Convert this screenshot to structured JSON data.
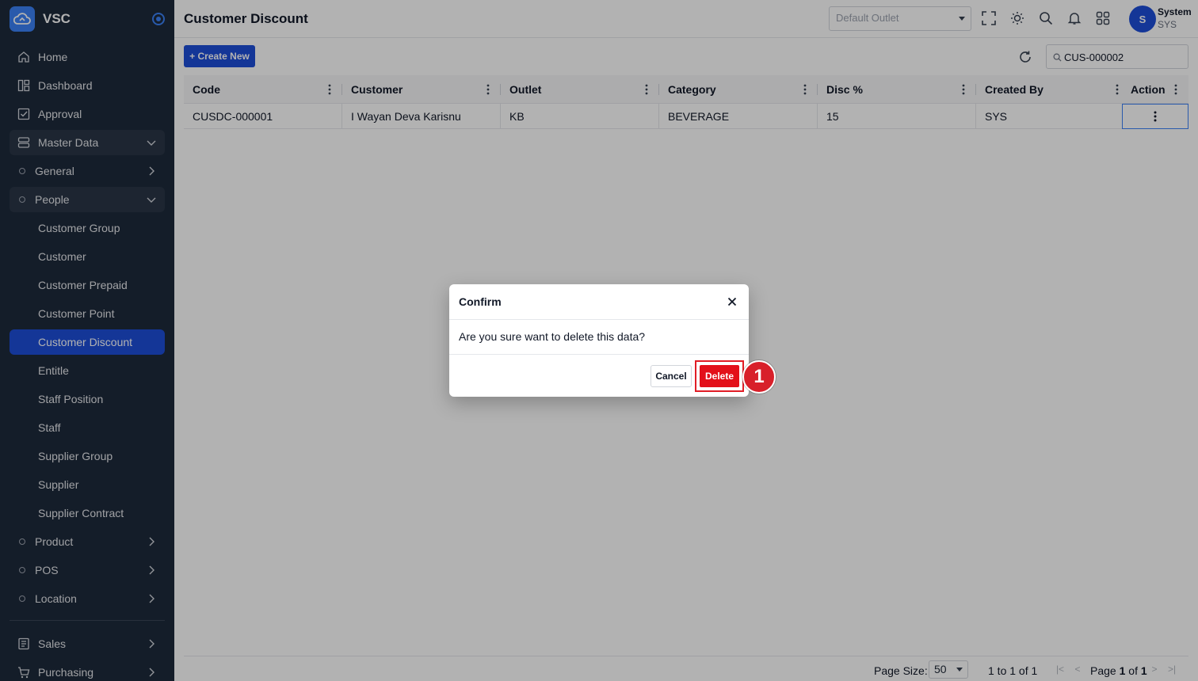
{
  "app": {
    "name": "VSC"
  },
  "sidebar": {
    "items": [
      {
        "label": "Home",
        "icon": "home-icon"
      },
      {
        "label": "Dashboard",
        "icon": "dashboard-icon"
      },
      {
        "label": "Approval",
        "icon": "approval-icon"
      },
      {
        "label": "Master Data",
        "icon": "database-icon"
      },
      {
        "label": "General"
      },
      {
        "label": "People"
      },
      {
        "label": "Customer Group"
      },
      {
        "label": "Customer"
      },
      {
        "label": "Customer Prepaid"
      },
      {
        "label": "Customer Point"
      },
      {
        "label": "Customer Discount"
      },
      {
        "label": "Entitle"
      },
      {
        "label": "Staff Position"
      },
      {
        "label": "Staff"
      },
      {
        "label": "Supplier Group"
      },
      {
        "label": "Supplier"
      },
      {
        "label": "Supplier Contract"
      },
      {
        "label": "Product"
      },
      {
        "label": "POS"
      },
      {
        "label": "Location"
      },
      {
        "label": "Sales",
        "icon": "sales-icon"
      },
      {
        "label": "Purchasing",
        "icon": "cart-icon"
      }
    ]
  },
  "header": {
    "title": "Customer Discount",
    "outlet_placeholder": "Default Outlet",
    "user": {
      "initial": "S",
      "name": "System",
      "role": "SYS"
    }
  },
  "toolbar": {
    "create_label": "+ Create New",
    "search_value": "CUS-000002"
  },
  "table": {
    "columns": [
      "Code",
      "Customer",
      "Outlet",
      "Category",
      "Disc %",
      "Created By",
      "Action"
    ],
    "rows": [
      {
        "code": "CUSDC-000001",
        "customer": "I Wayan Deva Karisnu",
        "outlet": "KB",
        "category": "BEVERAGE",
        "disc": "15",
        "created_by": "SYS"
      }
    ]
  },
  "pagination": {
    "page_size_label": "Page Size:",
    "page_size": "50",
    "range": "1 to 1 of 1",
    "page_label": "Page",
    "page_current": "1",
    "page_of": "of",
    "page_total": "1"
  },
  "dialog": {
    "title": "Confirm",
    "message": "Are you sure want to delete this data?",
    "cancel_label": "Cancel",
    "delete_label": "Delete"
  },
  "annotation": {
    "step": "1"
  },
  "colors": {
    "sidebar_bg": "#1e2a3b",
    "accent": "#1d4ed8",
    "danger": "#e3101a"
  }
}
